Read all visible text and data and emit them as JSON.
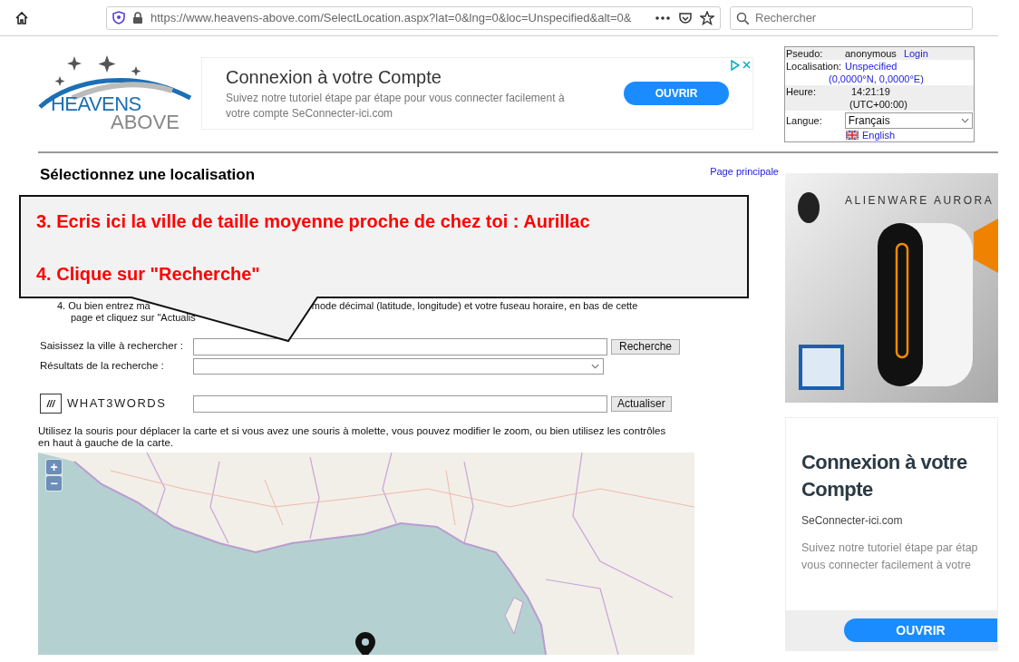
{
  "browser": {
    "url": "https://www.heavens-above.com/SelectLocation.aspx?lat=0&lng=0&loc=Unspecified&alt=0&",
    "search_placeholder": "Rechercher"
  },
  "logo": {
    "line1": "HEAVENS",
    "line2": "ABOVE"
  },
  "top_ad": {
    "title": "Connexion à votre Compte",
    "text": "Suivez notre tutoriel étape par étape pour vous connecter facilement à votre compte SeConnecter-ici.com",
    "button": "OUVRIR"
  },
  "user_box": {
    "pseudo_label": "Pseudo:",
    "pseudo": "anonymous",
    "login": "Login",
    "location_label": "Localisation:",
    "location": "Unspecified",
    "coordinates": "(0,0000°N, 0,0000°E)",
    "time_label": "Heure:",
    "time": "14:21:19",
    "timezone": "(UTC+00:00)",
    "language_label": "Langue:",
    "language": "Français",
    "alt_language": "English"
  },
  "page": {
    "title": "Sélectionnez une localisation",
    "home_link": "Page principale"
  },
  "instructions": {
    "line1_start": "4. Ou bien entrez ma",
    "line1_end": "mode décimal (latitude, longitude) et votre fuseau horaire, en bas de cette",
    "line2_start": "page et cliquez sur \"Actualis"
  },
  "search_form": {
    "city_label": "Saisissez la ville à rechercher :",
    "search_button": "Recherche",
    "results_label": "Résultats de la recherche :"
  },
  "what3words": {
    "mark": "///",
    "wordmark": "WHAT3WORDS",
    "button": "Actualiser"
  },
  "map": {
    "hint": "Utilisez la souris pour déplacer la carte et si vous avez une souris à molette, vous pouvez modifier le zoom, ou bien utilisez les contrôles en haut à gauche de la carte.",
    "zoom_in": "+",
    "zoom_out": "−"
  },
  "callout": {
    "lines": [
      "3. Ecris ici la ville de taille moyenne proche de chez toi : Aurillac",
      "4. Clique sur \"Recherche\""
    ]
  },
  "side_ad_1": {
    "brand": "ALIENWARE AURORA"
  },
  "side_ad_2": {
    "title": "Connexion à votre Compte",
    "source": "SeConnecter-ici.com",
    "lines": [
      "Suivez notre tutoriel étape par étap",
      "vous connecter facilement à votre"
    ],
    "button": "OUVRIR"
  }
}
